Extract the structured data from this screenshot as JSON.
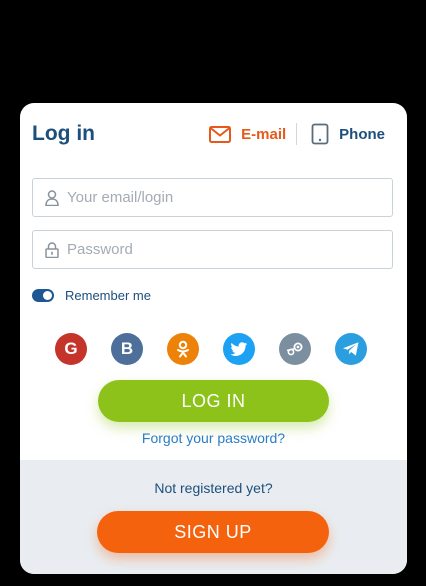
{
  "login": {
    "title": "Log in",
    "tabs": {
      "email": "E-mail",
      "phone": "Phone"
    },
    "email_field": {
      "placeholder": "Your email/login",
      "value": ""
    },
    "password_field": {
      "placeholder": "Password",
      "value": ""
    },
    "remember_label": "Remember me",
    "socials": [
      {
        "icon": "google-icon",
        "glyph": "G",
        "color": "#c4342b"
      },
      {
        "icon": "vk-icon",
        "glyph": "B",
        "color": "#4d6f9a"
      },
      {
        "icon": "odnoklassniki-icon",
        "glyph": "",
        "color": "#ee8208"
      },
      {
        "icon": "twitter-icon",
        "glyph": "",
        "color": "#1da1f2"
      },
      {
        "icon": "steam-icon",
        "glyph": "",
        "color": "#7c8fa0"
      },
      {
        "icon": "telegram-icon",
        "glyph": "",
        "color": "#2b9ee0"
      }
    ],
    "login_button": "LOG IN",
    "forgot_link": "Forgot your password?"
  },
  "register": {
    "prompt": "Not registered yet?",
    "signup_button": "SIGN UP"
  },
  "colors": {
    "accent_orange": "#e55a1b",
    "navy": "#1d4f7c",
    "login_green": "#8cc21a",
    "signup_orange": "#f4620e"
  }
}
